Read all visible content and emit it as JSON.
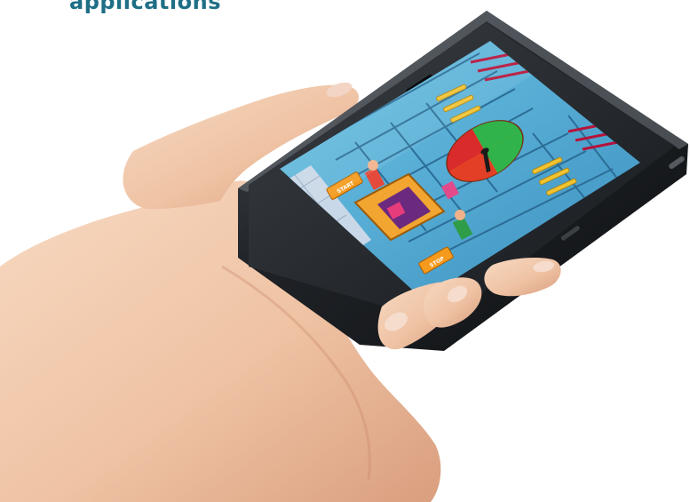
{
  "headline": "applications",
  "game": {
    "button_left": "START",
    "button_right": "STOP",
    "wheel_colors": [
      "#d92b2b",
      "#2fb34a",
      "#f5c400",
      "#ff6a1a"
    ]
  },
  "colors": {
    "headline": "#1d6f86",
    "skin": "#f2c8a9",
    "phone_body": "#2a2d31",
    "screen_bg": "#5db6d8"
  }
}
